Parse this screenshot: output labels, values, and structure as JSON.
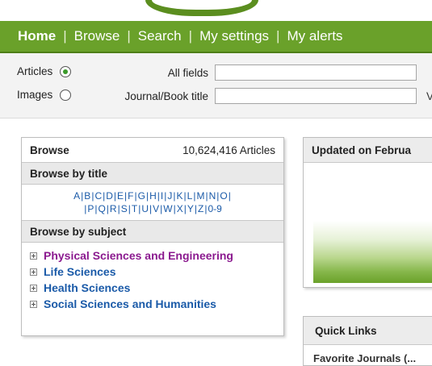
{
  "nav": {
    "items": [
      "Home",
      "Browse",
      "Search",
      "My settings",
      "My alerts"
    ],
    "separator": "|"
  },
  "search": {
    "types": [
      {
        "label": "Articles",
        "checked": true
      },
      {
        "label": "Images",
        "checked": false
      }
    ],
    "fields": [
      {
        "label": "All fields",
        "value": ""
      },
      {
        "label": "Journal/Book title",
        "value": ""
      }
    ],
    "cut_label": "V"
  },
  "browse": {
    "title": "Browse",
    "count": "10,624,416 Articles",
    "by_title_heading": "Browse by title",
    "letters": [
      "A",
      "B",
      "C",
      "D",
      "E",
      "F",
      "G",
      "H",
      "I",
      "J",
      "K",
      "L",
      "M",
      "N",
      "O",
      "P",
      "Q",
      "R",
      "S",
      "T",
      "U",
      "V",
      "W",
      "X",
      "Y",
      "Z",
      "0-9"
    ],
    "by_subject_heading": "Browse by subject",
    "subjects": [
      {
        "label": "Physical Sciences and Engineering",
        "color": "#8b1a8f"
      },
      {
        "label": "Life Sciences",
        "color": "#1a5aa8"
      },
      {
        "label": "Health Sciences",
        "color": "#1a5aa8"
      },
      {
        "label": "Social Sciences and Humanities",
        "color": "#1a5aa8"
      }
    ]
  },
  "updated": {
    "heading": "Updated on Februa"
  },
  "quick_links": {
    "heading": "Quick Links",
    "next_item": "Favorite Journals (..."
  },
  "colors": {
    "nav_bg": "#6aa12a",
    "link": "#1a5aa8",
    "visited": "#8b1a8f"
  }
}
